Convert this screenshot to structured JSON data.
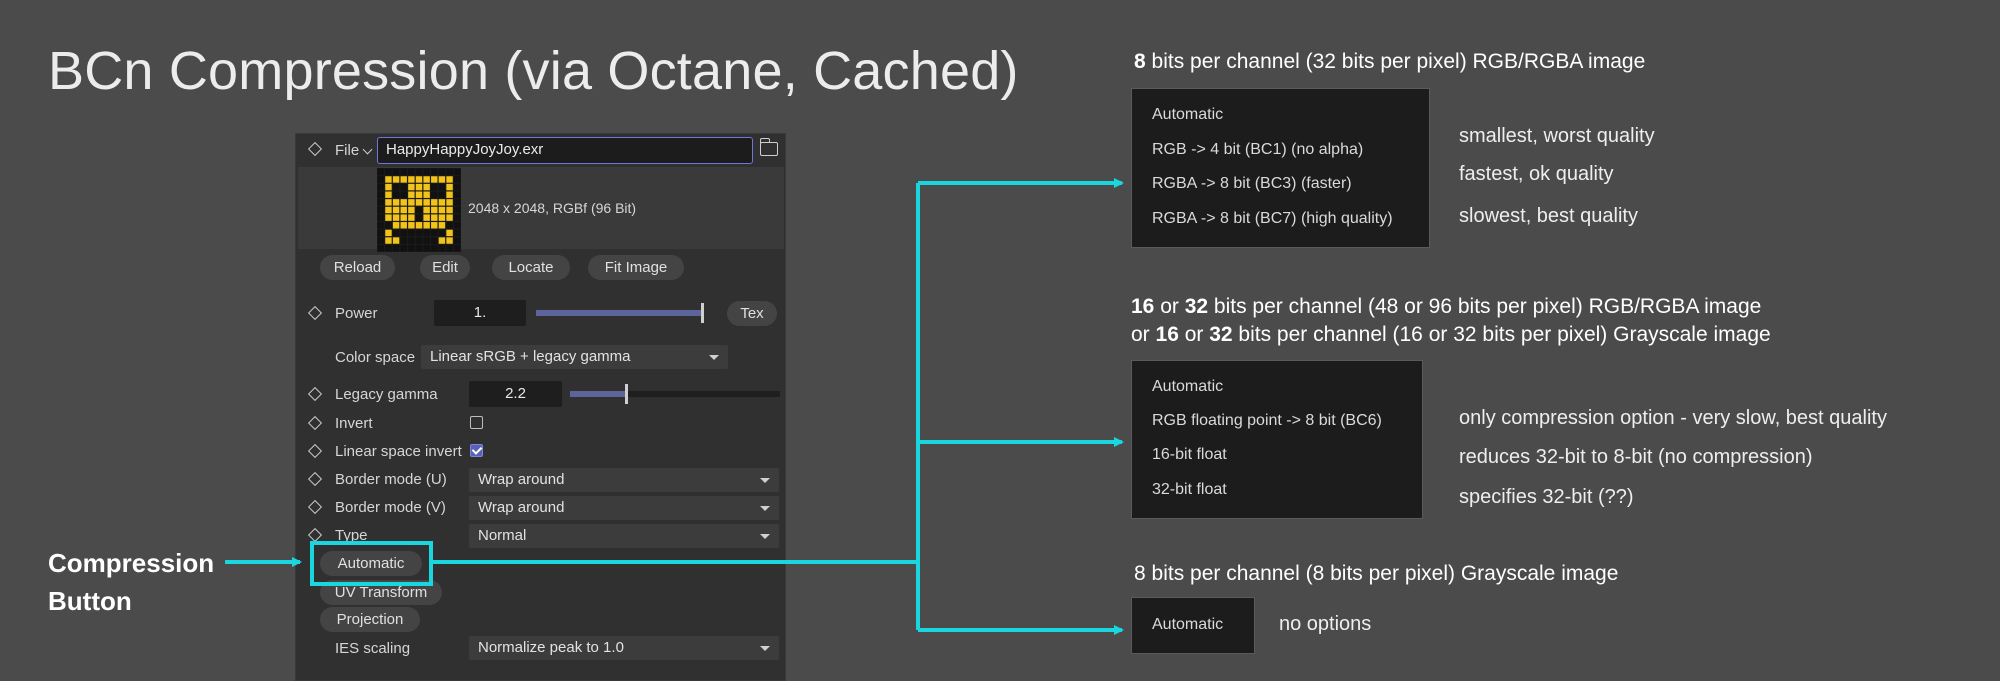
{
  "title": "BCn Compression (via Octane, Cached)",
  "panel": {
    "file_label": "File",
    "file_value": "HappyHappyJoyJoy.exr",
    "image_info": "2048 x 2048, RGBf (96 Bit)",
    "buttons": [
      "Reload",
      "Edit",
      "Locate",
      "Fit Image"
    ],
    "power_label": "Power",
    "power_value": "1.",
    "power_fraction": 1.0,
    "tex_button": "Tex",
    "color_space_label": "Color space",
    "color_space_value": "Linear sRGB + legacy gamma",
    "legacy_gamma_label": "Legacy gamma",
    "legacy_gamma_value": "2.2",
    "legacy_gamma_fraction": 0.27,
    "invert_label": "Invert",
    "invert_checked": false,
    "linear_space_invert_label": "Linear space invert",
    "linear_space_invert_checked": true,
    "border_u_label": "Border mode (U)",
    "border_u_value": "Wrap around",
    "border_v_label": "Border mode (V)",
    "border_v_value": "Wrap around",
    "type_label": "Type",
    "type_value": "Normal",
    "compression_button": "Automatic",
    "uv_transform_button": "UV Transform",
    "projection_button": "Projection",
    "ies_scaling_label": "IES scaling",
    "ies_scaling_value": "Normalize peak to 1.0"
  },
  "callout": {
    "line1": "Compression",
    "line2": "Button"
  },
  "groups": {
    "g8": {
      "caption_bold": "8",
      "caption_rest": " bits per channel (32 bits per pixel) RGB/RGBA image",
      "options": [
        "Automatic",
        "RGB  -> 4 bit (BC1) (no alpha)",
        "RGBA -> 8 bit (BC3) (faster)",
        "RGBA -> 8 bit (BC7) (high quality)"
      ],
      "notes": [
        "smallest, worst quality",
        "fastest, ok quality",
        "slowest, best quality"
      ]
    },
    "g16": {
      "line1_b1": "16",
      "line1_t1": " or ",
      "line1_b2": "32",
      "line1_t2": " bits per channel (48 or 96 bits per pixel) RGB/RGBA image",
      "line2_t0": "or ",
      "line2_b1": "16",
      "line2_t1": " or ",
      "line2_b2": "32",
      "line2_t2": " bits per channel (16 or 32 bits per pixel) Grayscale image",
      "options": [
        "Automatic",
        "RGB floating point -> 8 bit (BC6)",
        "16-bit float",
        "32-bit float"
      ],
      "notes": [
        "only compression option - very slow, best quality",
        "reduces 32-bit to 8-bit (no compression)",
        "specifies 32-bit (??)"
      ]
    },
    "ggray": {
      "caption": "8 bits per channel (8 bits per pixel) Grayscale image",
      "options": [
        "Automatic"
      ],
      "notes": [
        "no options"
      ]
    }
  },
  "colors": {
    "background": "#4b4b4b",
    "accent_cyan": "#19d6df",
    "panel_bg": "#303030",
    "slider_fill": "#5d639b",
    "smiley_yellow": "#f2c318"
  }
}
